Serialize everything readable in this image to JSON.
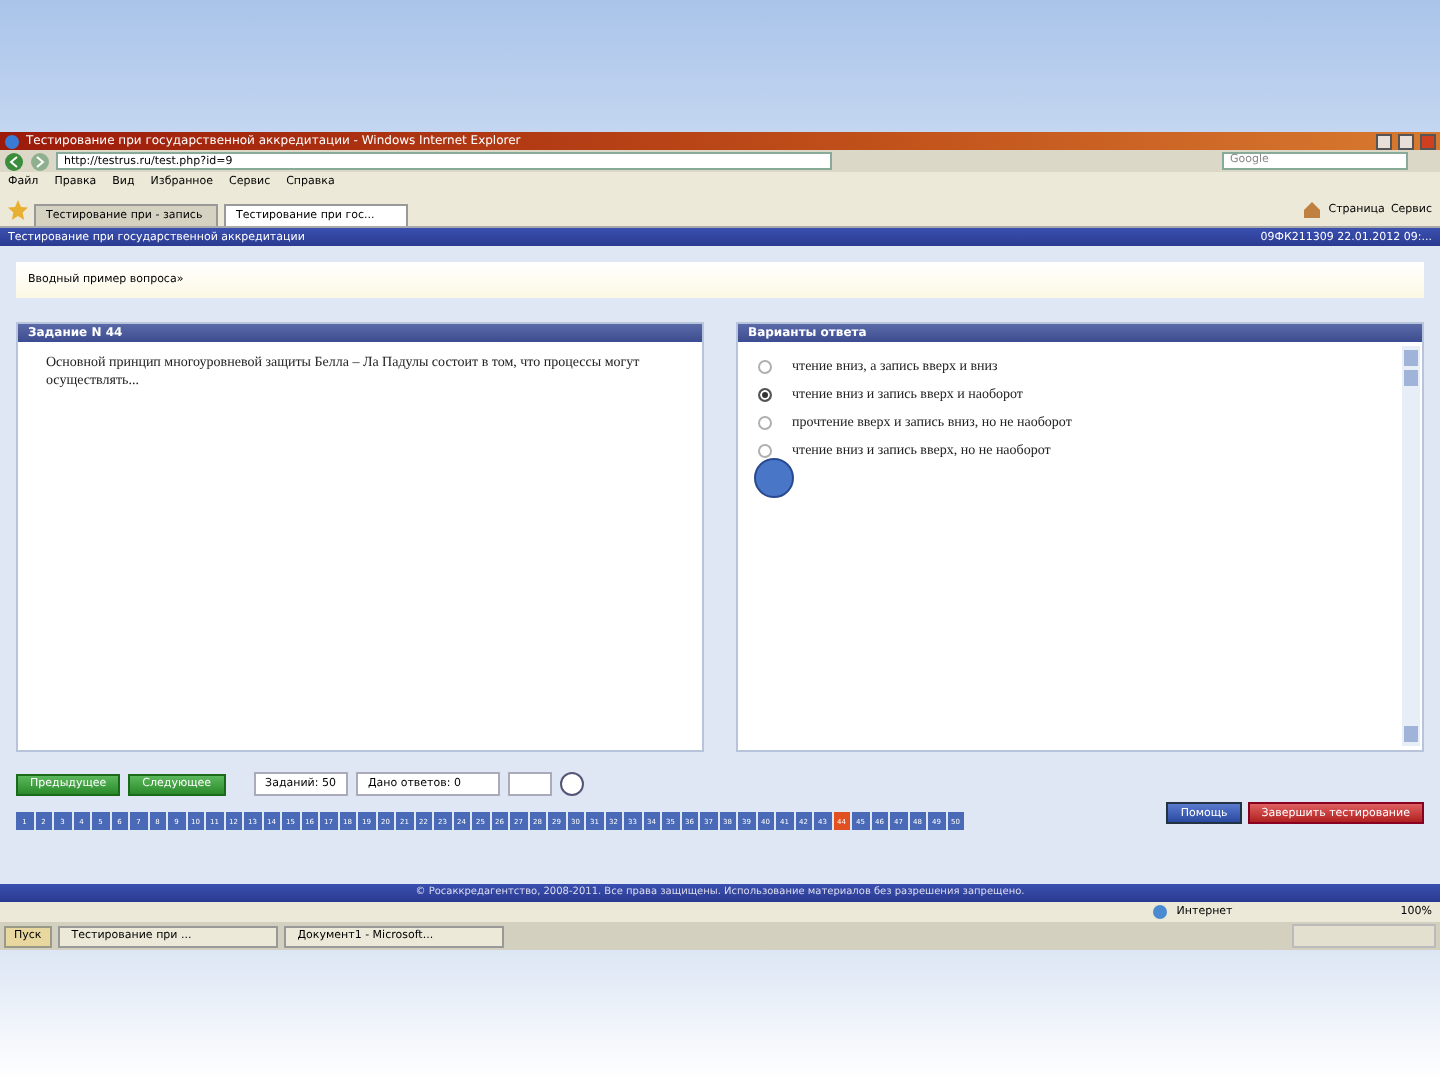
{
  "window": {
    "title": "Тестирование при государственной аккредитации - Windows Internet Explorer"
  },
  "address_bar": {
    "url": "http://testrus.ru/test.php?id=9",
    "search_placeholder": "Google"
  },
  "menu": [
    "Файл",
    "Правка",
    "Вид",
    "Избранное",
    "Сервис",
    "Справка"
  ],
  "browser_tabs": [
    {
      "label": "Тестирование при - запись",
      "selected": false
    },
    {
      "label": "Тестирование при гос...",
      "selected": true
    }
  ],
  "toolbar_right": [
    "Страница",
    "Сервис"
  ],
  "page_header": {
    "title": "Тестирование при государственной аккредитации",
    "session": "09ФК211309 22.01.2012 09:..."
  },
  "info_strip": "Вводный пример вопроса»",
  "question": {
    "header": "Задание N 44",
    "text": "Основной принцип многоуровневой защиты Белла – Ла Падулы состоит в том, что процессы могут осуществлять..."
  },
  "answers": {
    "header": "Варианты ответа",
    "options": [
      {
        "text": "чтение вниз, а запись вверх и вниз",
        "selected": false
      },
      {
        "text": "чтение вниз и запись вверх и наоборот",
        "selected": true
      },
      {
        "text": "прочтение вверх и запись вниз, но не наоборот",
        "selected": false
      },
      {
        "text": "чтение вниз и запись вверх, но не наоборот",
        "selected": false
      }
    ]
  },
  "controls": {
    "prev": "Предыдущее",
    "next": "Следующее",
    "total": "Заданий: 50",
    "answered": "Дано ответов: 0",
    "help": "Помощь",
    "finish": "Завершить тестирование"
  },
  "task_numbers": [
    {
      "label": "1",
      "current": false
    },
    {
      "label": "2",
      "current": false
    },
    {
      "label": "3",
      "current": false
    },
    {
      "label": "4",
      "current": false
    },
    {
      "label": "5",
      "current": false
    },
    {
      "label": "6",
      "current": false
    },
    {
      "label": "7",
      "current": false
    },
    {
      "label": "8",
      "current": false
    },
    {
      "label": "9",
      "current": false
    },
    {
      "label": "10",
      "current": false
    },
    {
      "label": "11",
      "current": false
    },
    {
      "label": "12",
      "current": false
    },
    {
      "label": "13",
      "current": false
    },
    {
      "label": "14",
      "current": false
    },
    {
      "label": "15",
      "current": false
    },
    {
      "label": "16",
      "current": false
    },
    {
      "label": "17",
      "current": false
    },
    {
      "label": "18",
      "current": false
    },
    {
      "label": "19",
      "current": false
    },
    {
      "label": "20",
      "current": false
    },
    {
      "label": "21",
      "current": false
    },
    {
      "label": "22",
      "current": false
    },
    {
      "label": "23",
      "current": false
    },
    {
      "label": "24",
      "current": false
    },
    {
      "label": "25",
      "current": false
    },
    {
      "label": "26",
      "current": false
    },
    {
      "label": "27",
      "current": false
    },
    {
      "label": "28",
      "current": false
    },
    {
      "label": "29",
      "current": false
    },
    {
      "label": "30",
      "current": false
    },
    {
      "label": "31",
      "current": false
    },
    {
      "label": "32",
      "current": false
    },
    {
      "label": "33",
      "current": false
    },
    {
      "label": "34",
      "current": false
    },
    {
      "label": "35",
      "current": false
    },
    {
      "label": "36",
      "current": false
    },
    {
      "label": "37",
      "current": false
    },
    {
      "label": "38",
      "current": false
    },
    {
      "label": "39",
      "current": false
    },
    {
      "label": "40",
      "current": false
    },
    {
      "label": "41",
      "current": false
    },
    {
      "label": "42",
      "current": false
    },
    {
      "label": "43",
      "current": false
    },
    {
      "label": "44",
      "current": true
    },
    {
      "label": "45",
      "current": false
    },
    {
      "label": "46",
      "current": false
    },
    {
      "label": "47",
      "current": false
    },
    {
      "label": "48",
      "current": false
    },
    {
      "label": "49",
      "current": false
    },
    {
      "label": "50",
      "current": false
    }
  ],
  "footer": "© Росаккредагентство, 2008-2011. Все права защищены. Использование материалов без разрешения запрещено.",
  "status_bar": {
    "zone": "Интернет",
    "zoom": "100%"
  },
  "taskbar": {
    "start": "Пуск",
    "items": [
      "Тестирование при ...",
      "Документ1 - Microsoft..."
    ]
  }
}
